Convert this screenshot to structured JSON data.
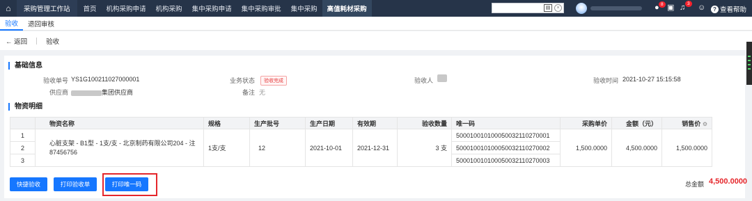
{
  "topbar": {
    "home_icon": "home-icon",
    "app_title": "采购管理工作站",
    "nav": [
      "首页",
      "机构采购申请",
      "机构采购",
      "集中采购申请",
      "集中采购审批",
      "集中采购",
      "高值耗材采购"
    ],
    "active_nav": "高值耗材采购",
    "help_label": "查看帮助",
    "chat_badge": "8",
    "bell_badge": "3",
    "search_value": ""
  },
  "subtabs": [
    "验收",
    "退回审核"
  ],
  "breadcrumb": {
    "back": "← 返回",
    "current": "验收"
  },
  "basic": {
    "title": "基础信息",
    "receipt_no_label": "验收单号",
    "receipt_no": "YS1G100211027000001",
    "status_label": "业务状态",
    "status": "验收完成",
    "inspector_label": "验收人",
    "time_label": "验收时间",
    "time": "2021-10-27 15:15:58",
    "supplier_label": "供应商",
    "supplier_suffix": "集团供应商",
    "remark_label": "备注",
    "remark": "无"
  },
  "detail": {
    "title": "物资明细",
    "columns": [
      "",
      "物资名称",
      "规格",
      "生产批号",
      "生产日期",
      "有效期",
      "验收数量",
      "唯一码",
      "采购单价",
      "金额（元）",
      "销售价"
    ],
    "row_numbers": [
      "1",
      "2",
      "3"
    ],
    "item": {
      "name": "心脏支架 - B1型 - 1支/支 - 北京制药有限公司204 - 注87456756",
      "spec": "1支/支",
      "batch": "12",
      "mfg_date": "2021-10-01",
      "expiry": "2021-12-31",
      "qty": "3 支",
      "codes": [
        "500010010100050032110270001",
        "500010010100050032110270002",
        "500010010100050032110270003"
      ],
      "unit_price": "1,500.0000",
      "amount": "4,500.0000",
      "sale_price": "1,500.0000"
    }
  },
  "actions": {
    "quick_receive": "快捷验收",
    "print_receipt": "打印验收单",
    "print_code": "打印唯一码",
    "total_label": "总金额",
    "total_value": "4,500.0000"
  },
  "colors": {
    "nav_bg": "#263449",
    "accent": "#1677ff",
    "danger": "#e5262b"
  }
}
